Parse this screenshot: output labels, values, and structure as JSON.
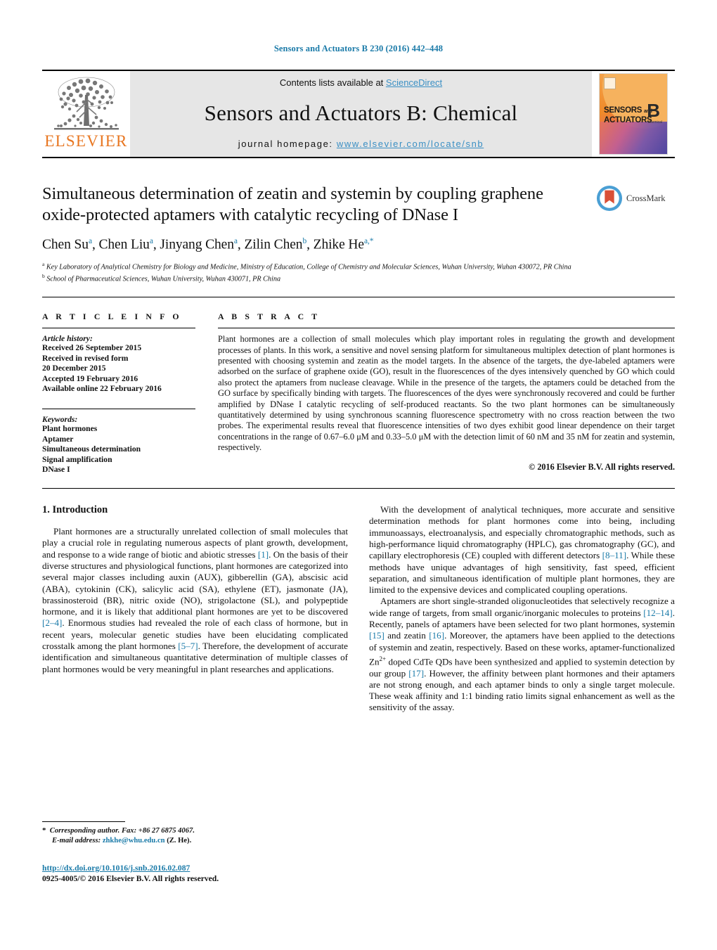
{
  "running_head": "Sensors and Actuators B 230 (2016) 442–448",
  "masthead": {
    "publisher_name": "ELSEVIER",
    "contents_prefix": "Contents lists available at ",
    "contents_link": "ScienceDirect",
    "journal_name": "Sensors and Actuators B: Chemical",
    "homepage_prefix": "journal homepage: ",
    "homepage_link": "www.elsevier.com/locate/snb",
    "cover": {
      "line1": "SENSORS",
      "and": "and",
      "line2": "ACTUATORS",
      "letter": "B",
      "sub": "Chemical"
    }
  },
  "article": {
    "title": "Simultaneous determination of zeatin and systemin by coupling graphene oxide-protected aptamers with catalytic recycling of DNase I",
    "crossmark_label": "CrossMark",
    "authors_html": "Chen Su<sup>a</sup>, Chen Liu<sup>a</sup>, Jinyang Chen<sup>a</sup>, Zilin Chen<sup>b</sup>, Zhike He<sup>a,</sup><sup>*</sup>",
    "affiliation_a": "Key Laboratory of Analytical Chemistry for Biology and Medicine, Ministry of Education, College of Chemistry and Molecular Sciences, Wuhan University, Wuhan 430072, PR China",
    "affiliation_b": "School of Pharmaceutical Sciences, Wuhan University, Wuhan 430071, PR China"
  },
  "article_info": {
    "heading": "A R T I C L E    I N F O",
    "history_label": "Article history:",
    "history": [
      "Received 26 September 2015",
      "Received in revised form",
      "20 December 2015",
      "Accepted 19 February 2016",
      "Available online 22 February 2016"
    ],
    "keywords_label": "Keywords:",
    "keywords": [
      "Plant hormones",
      "Aptamer",
      "Simultaneous determination",
      "Signal amplification",
      "DNase I"
    ]
  },
  "abstract": {
    "heading": "A B S T R A C T",
    "text": "Plant hormones are a collection of small molecules which play important roles in regulating the growth and development processes of plants. In this work, a sensitive and novel sensing platform for simultaneous multiplex detection of plant hormones is presented with choosing systemin and zeatin as the model targets. In the absence of the targets, the dye-labeled aptamers were adsorbed on the surface of graphene oxide (GO), result in the fluorescences of the dyes intensively quenched by GO which could also protect the aptamers from nuclease cleavage. While in the presence of the targets, the aptamers could be detached from the GO surface by specifically binding with targets. The fluorescences of the dyes were synchronously recovered and could be further amplified by DNase I catalytic recycling of self-produced reactants. So the two plant hormones can be simultaneously quantitatively determined by using synchronous scanning fluorescence spectrometry with no cross reaction between the two probes. The experimental results reveal that fluorescence intensities of two dyes exhibit good linear dependence on their target concentrations in the range of 0.67–6.0 μM and 0.33–5.0 μM with the detection limit of 60 nM and 35 nM for zeatin and systemin, respectively.",
    "copyright": "© 2016 Elsevier B.V. All rights reserved."
  },
  "introduction": {
    "heading": "1.  Introduction",
    "paragraph_1_html": "Plant hormones are a structurally unrelated collection of small molecules that play a crucial role in regulating numerous aspects of plant growth, development, and response to a wide range of biotic and abiotic stresses <span class=\"ref\">[1]</span>. On the basis of their diverse structures and physiological functions, plant hormones are categorized into several major classes including auxin (AUX), gibberellin (GA), abscisic acid (ABA), cytokinin (CK), salicylic acid (SA), ethylene (ET), jasmonate (JA), brassinosteroid (BR), nitric oxide (NO), strigolactone (SL), and polypeptide hormone, and it is likely that additional plant hormones are yet to be discovered <span class=\"ref\">[2–4]</span>. Enormous studies had revealed the role of each class of hormone, but in recent years, molecular genetic studies have been elucidating complicated crosstalk among the plant hormones <span class=\"ref\">[5–7]</span>. Therefore, the development of accurate identification and simultaneous quantitative determination of multiple classes of plant hormones would be very meaningful in plant researches and applications.",
    "paragraph_2_html": "With the development of analytical techniques, more accurate and sensitive determination methods for plant hormones come into being, including immunoassays, electroanalysis, and especially chromatographic methods, such as high-performance liquid chromatography (HPLC), gas chromatography (GC), and capillary electrophoresis (CE) coupled with different detectors <span class=\"ref\">[8–11]</span>. While these methods have unique advantages of high sensitivity, fast speed, efficient separation, and simultaneous identification of multiple plant hormones, they are limited to the expensive devices and complicated coupling operations.",
    "paragraph_3_html": "Aptamers are short single-stranded oligonucleotides that selectively recognize a wide range of targets, from small organic/inorganic molecules to proteins <span class=\"ref\">[12–14]</span>. Recently, panels of aptamers have been selected for two plant hormones, systemin <span class=\"ref\">[15]</span> and zeatin <span class=\"ref\">[16]</span>. Moreover, the aptamers have been applied to the detections of systemin and zeatin, respectively. Based on these works, aptamer-functionalized Zn<sup class=\"small\">2+</sup> doped CdTe QDs have been synthesized and applied to systemin detection by our group <span class=\"ref\">[17]</span>. However, the affinity between plant hormones and their aptamers are not strong enough, and each aptamer binds to only a single target molecule. These weak affinity and 1:1 binding ratio limits signal enhancement as well as the sensitivity of the assay."
  },
  "footnotes": {
    "corresponding_html": "<span class=\"fn-star\">*</span>&nbsp; <span class=\"fn-ital\">Corresponding author. Fax: +86 27 6875 4067.</span>",
    "email_html": "<span class=\"fn-ital\">E-mail address:</span> <span class=\"fn-link\">zhkhe@whu.edu.cn</span> (Z. He).",
    "doi": "http://dx.doi.org/10.1016/j.snb.2016.02.087",
    "issn": "0925-4005/© 2016 Elsevier B.V. All rights reserved."
  },
  "colors": {
    "link_blue": "#1a7aa8",
    "sciencedirect_blue": "#3a8fc4",
    "elsevier_orange": "#E87722",
    "band_gray": "#e6e6e6"
  }
}
